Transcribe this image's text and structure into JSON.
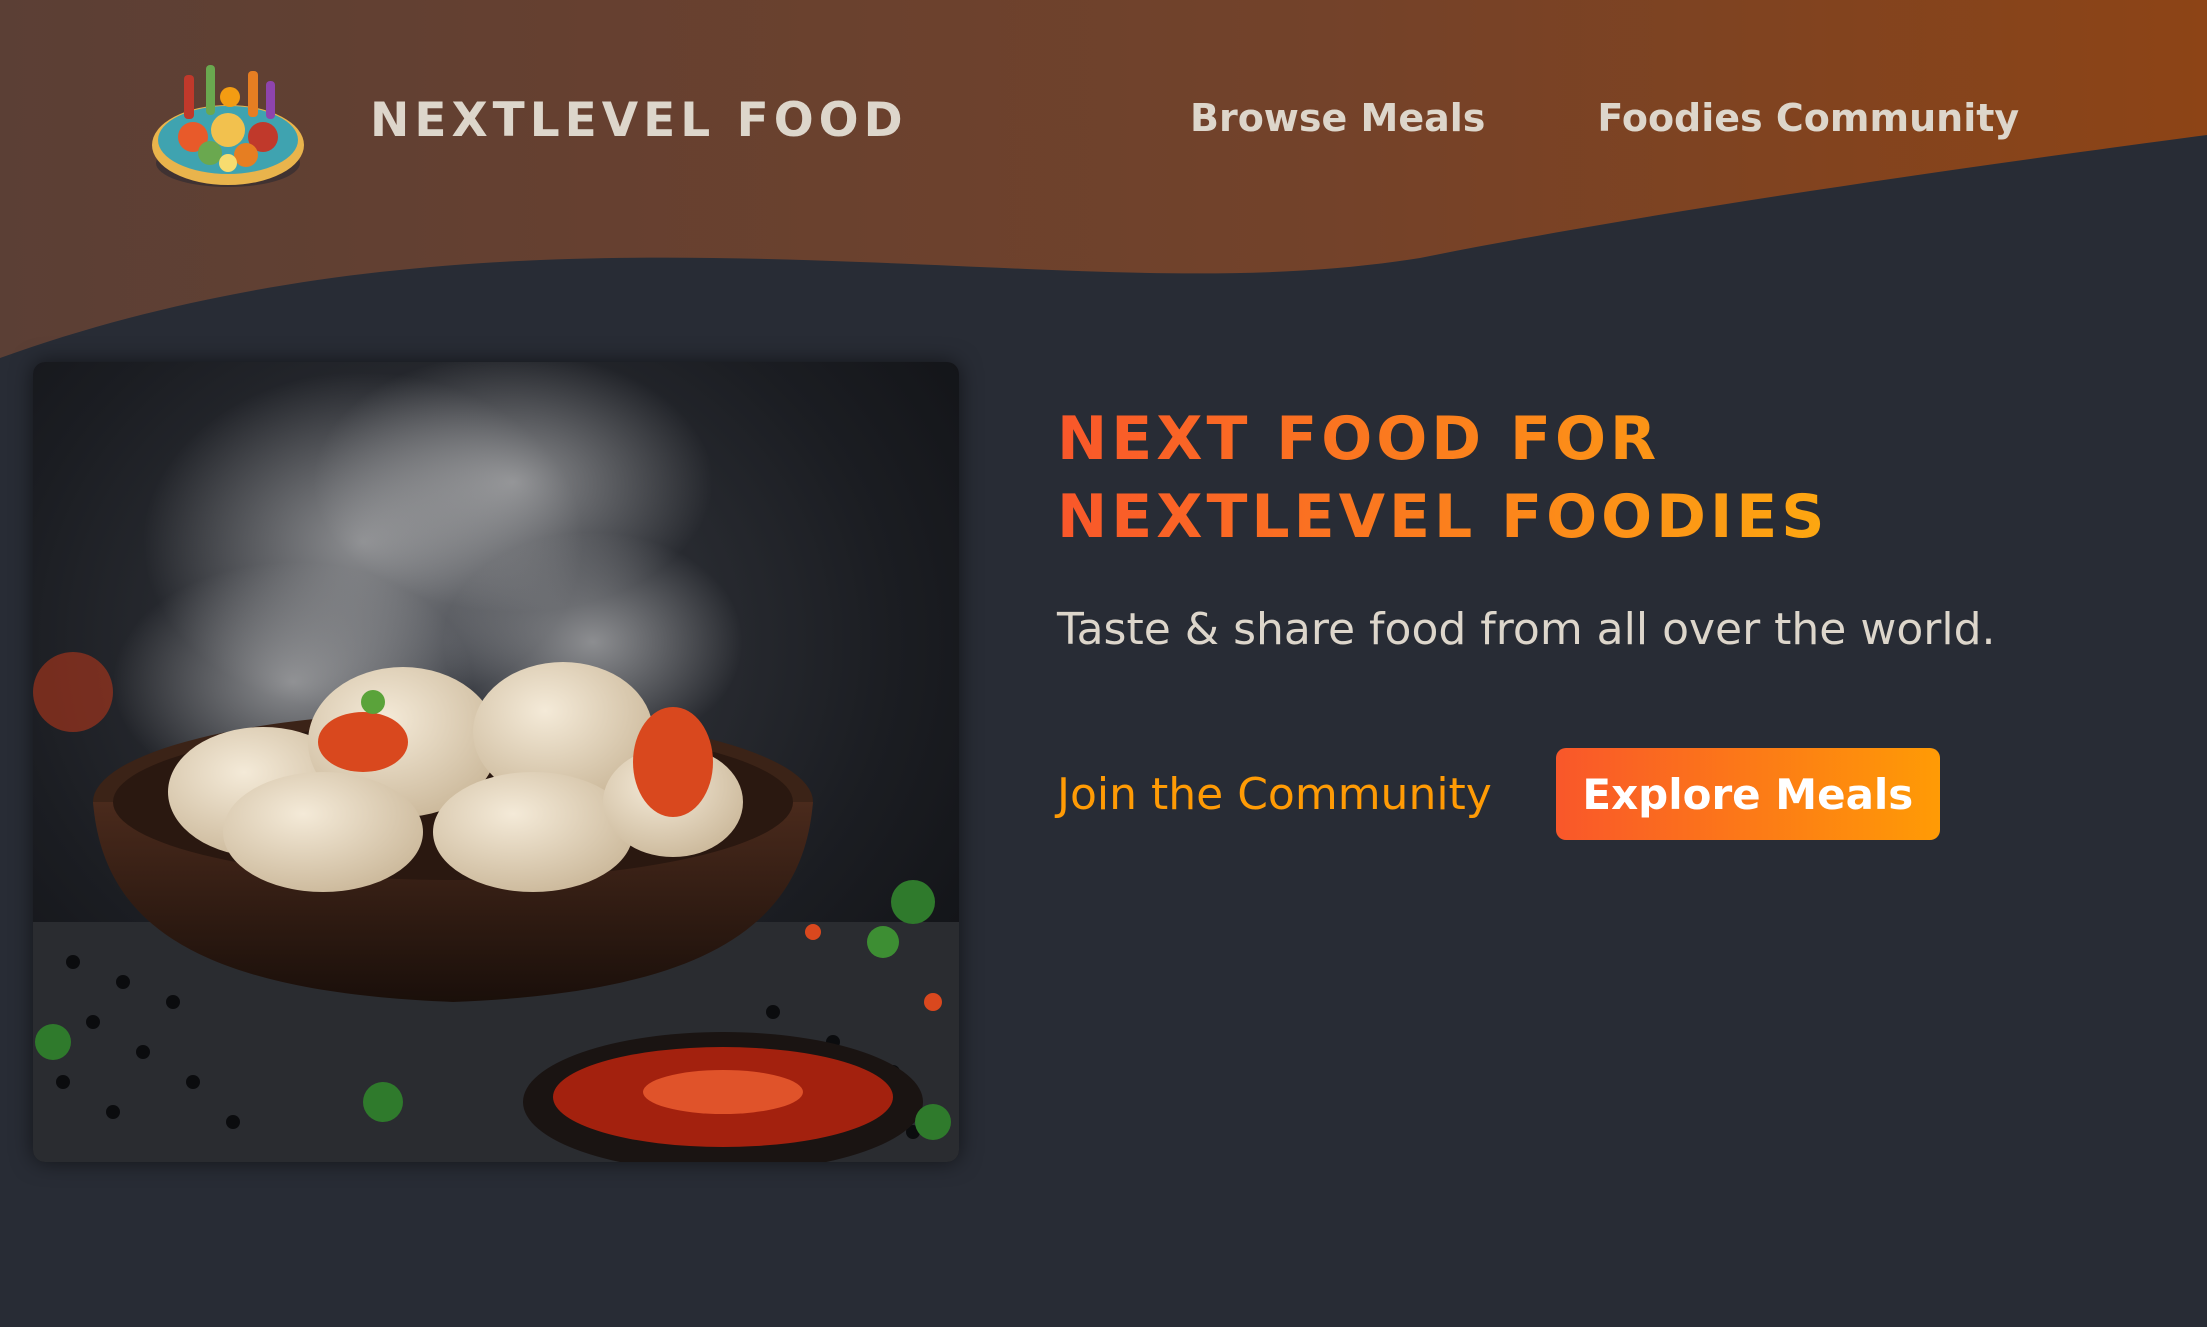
{
  "header": {
    "logo_text": "NEXTLEVEL FOOD",
    "logo_icon": "food-platter-icon",
    "nav": [
      {
        "label": "Browse Meals"
      },
      {
        "label": "Foodies Community"
      }
    ]
  },
  "hero": {
    "image_icon": "dumplings-photo",
    "title_line1": "NEXT FOOD FOR",
    "title_line2": "NEXTLEVEL FOODIES",
    "subtitle": "Taste & share food from all over the world.",
    "cta_link": "Join the Community",
    "cta_button": "Explore Meals"
  },
  "colors": {
    "background": "#282c35",
    "header_gradient_start": "#5a3e33",
    "header_gradient_end": "#8a4419",
    "accent_orange": "#f9572a",
    "accent_yellow": "#ffc905",
    "link_orange": "#ff9b05",
    "text_light": "#ddd6cb"
  }
}
